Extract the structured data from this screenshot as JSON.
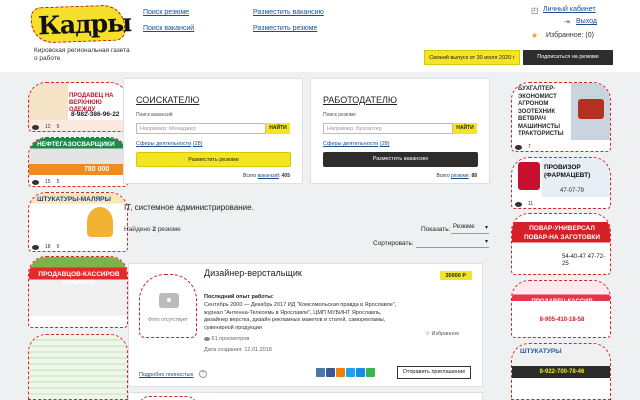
{
  "header": {
    "logo_text": "Кадры",
    "tagline": "Кировская региональная газета о работе",
    "nav": {
      "search_resume": "Поиск резюме",
      "search_vacancies": "Поиск вакансий",
      "post_vacancy": "Разместить вакансию",
      "post_resume": "Разместить резюме"
    },
    "account": {
      "cabinet": "Личный кабинет",
      "logout": "Выход",
      "favorites": "Избранное: (0)"
    },
    "fresh_issue": "Свежий выпуск от 30 июля 2020 г",
    "subscribe": "Подписаться на резюме"
  },
  "seeker": {
    "title": "СОИСКАТЕЛЮ",
    "search_label": "Поиск вакансий",
    "placeholder": "Например: Менеджер",
    "find": "НАЙТИ",
    "fields_label": "Сферы деятельности",
    "fields_count": "(28)",
    "action": "Разместить резюме",
    "total_prefix": "Всего",
    "total_link": "вакансий",
    "total_count": "405"
  },
  "employer": {
    "title": "РАБОТОДАТЕЛЮ",
    "search_label": "Поиск резюме",
    "placeholder": "Например: Бухгалтер",
    "find": "НАЙТИ",
    "fields_label": "Сферы деятельности",
    "fields_count": "(28)",
    "action": "Разместить вакансию",
    "total_prefix": "Всего",
    "total_link": "резюме",
    "total_count": "88"
  },
  "listing": {
    "category": "IT, системное администрирование.",
    "found_prefix": "Найдено",
    "found_count": "2",
    "found_suffix": "резюме",
    "show_label": "Показать:",
    "show_value": "Резюме",
    "sort_label": "Сортировать:",
    "sort_value": ""
  },
  "resume": {
    "photo_caption": "Фото отсутствует",
    "title": "Дизайнер-верстальщик",
    "salary": "30000 Р",
    "exp_label": "Последний опыт работы:",
    "exp_text": "Сентябрь 2000 — Декабрь 2017 ИД \"Комсомольская правда в Ярославле\", журнал \"Антенна-Телесемь в Ярославле\", ЦМП МУБИНТ Ярославль, дизайнер верстка, дизайн рекламных макетов и статей, саморекламы, сувенирной продукции",
    "views": "61 просмотров",
    "created": "Дата создания: 12.01.2018",
    "favorite": "Избранное",
    "details": "Подробно полностью",
    "invite": "Отправить приглашение"
  },
  "ads_left": [
    {
      "headline": "ПРОДАВЕЦ НА ВЕРХНЮЮ ОДЕЖДУ",
      "phone": "8-982-386-96-22",
      "views": "12",
      "day": "5"
    },
    {
      "headline": "НЕФТЕГАЗОСВАРЩИКИ",
      "phone": "780 000",
      "views": "15",
      "day": "5"
    },
    {
      "headline": "ШТУКАТУРЫ-МАЛЯРЫ",
      "phone": "",
      "views": "18",
      "day": "6"
    },
    {
      "headline": "ПРОДАВЦОВ-КАССИРОВ ПОВАРОВ",
      "phone": "",
      "views": "",
      "day": ""
    },
    {
      "headline": "",
      "phone": "",
      "views": "",
      "day": ""
    }
  ],
  "ads_right": [
    {
      "headline": "БУХГАЛТЕР-ЭКОНОМИСТ АГРОНОМ ЗООТЕХНИК ВЕТВРАЧ МАШИНИСТЫ ТРАКТОРИСТЫ",
      "phone": "",
      "views": "",
      "day": "7"
    },
    {
      "headline": "ПРОВИЗОР (ФАРМАЦЕВТ)",
      "phone": "47-07-79",
      "views": "",
      "day": "11"
    },
    {
      "headline": "ПОВАР-УНИВЕРСАЛ ПОВАР-НА ЗАГОТОВКИ",
      "phone": "54-40-47 47-72-25",
      "views": "",
      "day": ""
    },
    {
      "headline": "ПРОДАВЕЦ-КАССИР",
      "phone": "8-905-410-18-58",
      "views": "",
      "day": ""
    },
    {
      "headline": "ШТУКАТУРЫ",
      "phone": "8-922-700-78-46",
      "views": "",
      "day": ""
    }
  ],
  "colors": {
    "accent": "#f3e523",
    "link": "#1a4d8f",
    "ad_border": "#d22"
  }
}
